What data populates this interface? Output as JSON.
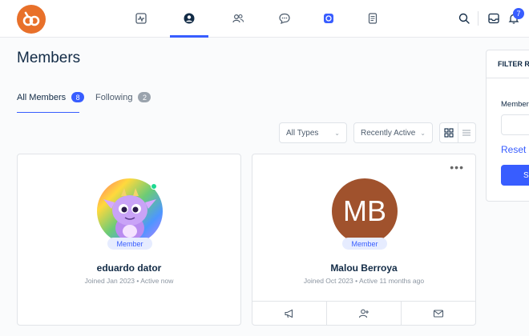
{
  "header": {
    "notification_count": "7",
    "accent_color": "#385dff",
    "logo_color": "#e8702a",
    "nav_icons": [
      "activity-icon",
      "profile-icon",
      "members-icon",
      "messages-icon",
      "app-icon",
      "document-icon"
    ],
    "right_icons": [
      "search-icon",
      "inbox-icon",
      "bell-icon"
    ]
  },
  "page": {
    "title": "Members"
  },
  "tabs": [
    {
      "label": "All Members",
      "count": "8",
      "active": true
    },
    {
      "label": "Following",
      "count": "2",
      "active": false
    }
  ],
  "filters": {
    "type_select": "All Types",
    "order_select": "Recently Active"
  },
  "members": [
    {
      "name": "eduardo dator",
      "role": "Member",
      "meta": "Joined Jan 2023 • Active now",
      "avatar": "dragon-avatar-image"
    },
    {
      "name": "Malou Berroya",
      "role": "Member",
      "meta": "Joined Oct 2023 • Active 11 months ago",
      "initials": "MB"
    }
  ],
  "filter_panel": {
    "title": "FILTER RE",
    "label": "Member",
    "reset": "Reset",
    "submit": "S"
  }
}
